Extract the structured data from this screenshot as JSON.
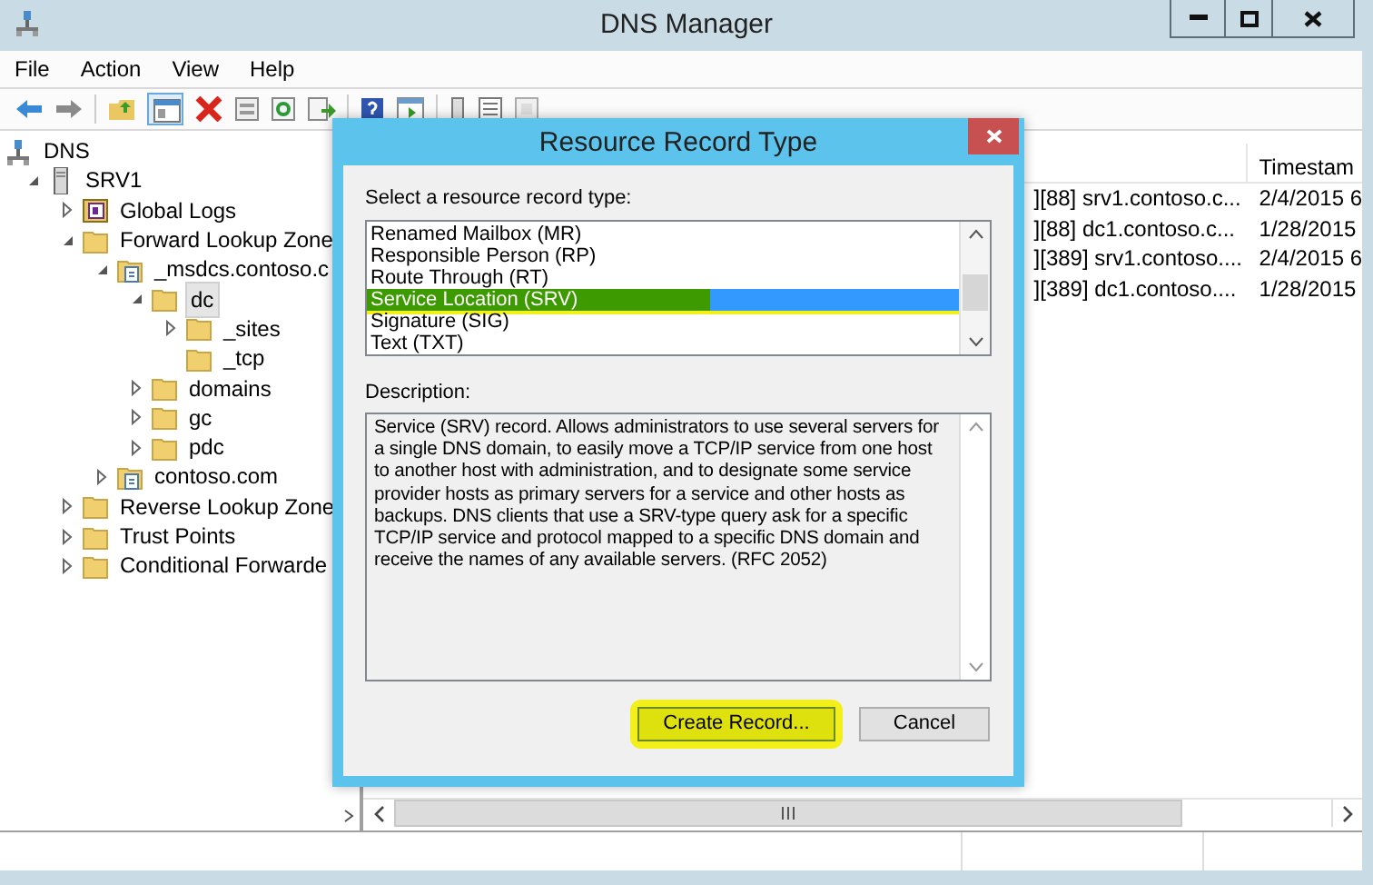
{
  "window": {
    "title": "DNS Manager"
  },
  "menu": [
    "File",
    "Action",
    "View",
    "Help"
  ],
  "tree": [
    {
      "label": "DNS",
      "kind": "dns",
      "selected": false,
      "children": [
        {
          "label": "SRV1",
          "kind": "server",
          "expanded": true,
          "selected": false,
          "children": [
            {
              "label": "Global Logs",
              "kind": "log",
              "expanded": false,
              "selected": false
            },
            {
              "label": "Forward Lookup Zone",
              "kind": "folder",
              "expanded": true,
              "selected": false,
              "children": [
                {
                  "label": "_msdcs.contoso.c",
                  "kind": "zone",
                  "expanded": true,
                  "selected": false,
                  "children": [
                    {
                      "label": "dc",
                      "kind": "folder",
                      "expanded": true,
                      "selected": true,
                      "children": [
                        {
                          "label": "_sites",
                          "kind": "folder",
                          "expanded": false,
                          "selected": false
                        },
                        {
                          "label": "_tcp",
                          "kind": "folder",
                          "selected": false
                        }
                      ]
                    },
                    {
                      "label": "domains",
                      "kind": "folder",
                      "expanded": false,
                      "selected": false
                    },
                    {
                      "label": "gc",
                      "kind": "folder",
                      "expanded": false,
                      "selected": false
                    },
                    {
                      "label": "pdc",
                      "kind": "folder",
                      "expanded": false,
                      "selected": false
                    }
                  ]
                },
                {
                  "label": "contoso.com",
                  "kind": "zone",
                  "expanded": false,
                  "selected": false
                }
              ]
            },
            {
              "label": "Reverse Lookup Zone",
              "kind": "folder",
              "expanded": false,
              "selected": false
            },
            {
              "label": "Trust Points",
              "kind": "folder",
              "expanded": false,
              "selected": false
            },
            {
              "label": "Conditional Forwarde",
              "kind": "folder",
              "expanded": false,
              "selected": false
            }
          ]
        }
      ]
    }
  ],
  "list": {
    "columns": [
      "",
      "Timestam"
    ],
    "rows": [
      [
        "][88] srv1.contoso.c...",
        "2/4/2015 6"
      ],
      [
        "][88] dc1.contoso.c...",
        "1/28/2015"
      ],
      [
        "][389] srv1.contoso....",
        "2/4/2015 6"
      ],
      [
        "][389] dc1.contoso....",
        "1/28/2015"
      ]
    ]
  },
  "dialog": {
    "title": "Resource Record Type",
    "list_label": "Select a resource record type:",
    "items": [
      {
        "label": "Renamed Mailbox (MR)",
        "selected": false,
        "highlighted": false
      },
      {
        "label": "Responsible Person (RP)",
        "selected": false,
        "highlighted": false
      },
      {
        "label": "Route Through (RT)",
        "selected": false,
        "highlighted": false
      },
      {
        "label": "Service Location (SRV)",
        "selected": true,
        "highlighted": true
      },
      {
        "label": "Signature (SIG)",
        "selected": false,
        "highlighted": false
      },
      {
        "label": "Text (TXT)",
        "selected": false,
        "highlighted": false
      }
    ],
    "description_label": "Description:",
    "description": "Service (SRV) record. Allows administrators to use several servers for a single DNS domain, to easily move a TCP/IP service from one host to another host with administration, and to designate some service provider hosts as primary servers for a service and other hosts as backups. DNS clients that use a SRV-type query ask for a specific TCP/IP service and protocol mapped to a specific DNS domain and receive the names of any available servers. (RFC 2052)",
    "buttons": [
      {
        "label": "Create Record...",
        "highlighted": true
      },
      {
        "label": "Cancel",
        "highlighted": false
      }
    ]
  }
}
